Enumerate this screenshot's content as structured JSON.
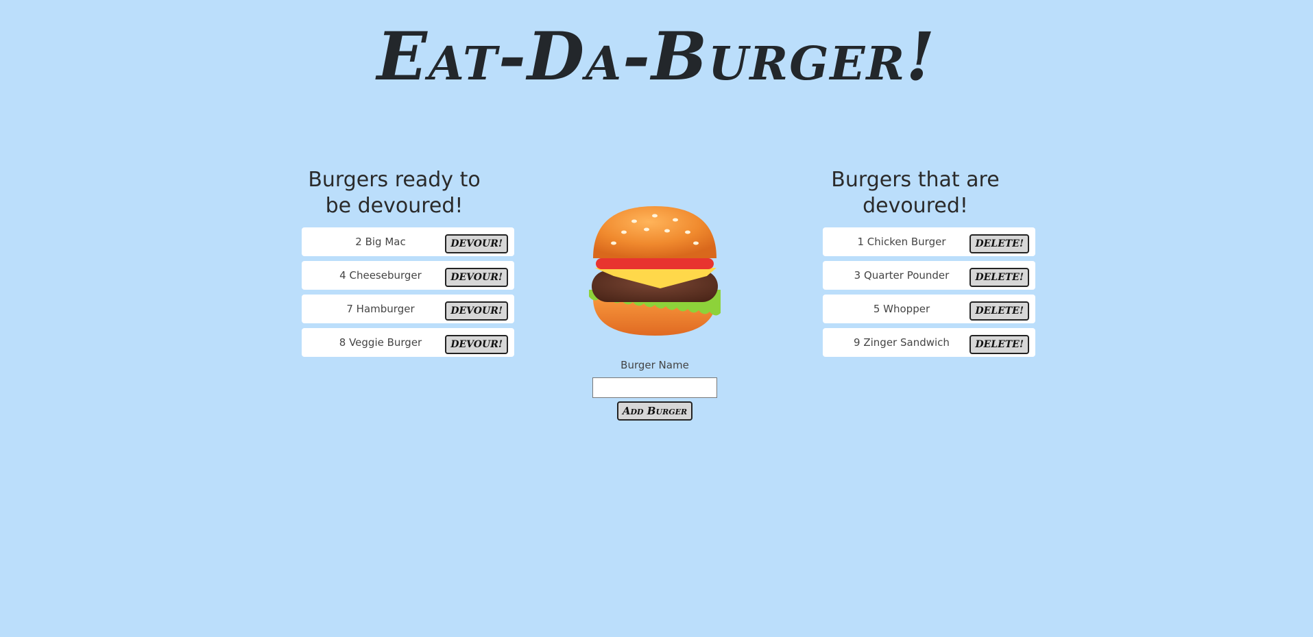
{
  "header": {
    "title": "Eat-Da-Burger!"
  },
  "ready": {
    "heading": "Burgers ready to be devoured!",
    "items": [
      {
        "label": "2 Big Mac",
        "button": "DEVOUR!"
      },
      {
        "label": "4 Cheeseburger",
        "button": "DEVOUR!"
      },
      {
        "label": "7 Hamburger",
        "button": "DEVOUR!"
      },
      {
        "label": "8 Veggie Burger",
        "button": "DEVOUR!"
      }
    ]
  },
  "devoured": {
    "heading": "Burgers that are devoured!",
    "items": [
      {
        "label": "1 Chicken Burger",
        "button": "DELETE!"
      },
      {
        "label": "3 Quarter Pounder",
        "button": "DELETE!"
      },
      {
        "label": "5 Whopper",
        "button": "DELETE!"
      },
      {
        "label": "9 Zinger Sandwich",
        "button": "DELETE!"
      }
    ]
  },
  "form": {
    "label": "Burger Name",
    "input_value": "",
    "submit_label": "Add Burger"
  },
  "theme": {
    "background": "#bbdefb",
    "card": "#ffffff",
    "button": "#d7d7d7"
  },
  "icons": {
    "burger": "hamburger-emoji-icon"
  }
}
